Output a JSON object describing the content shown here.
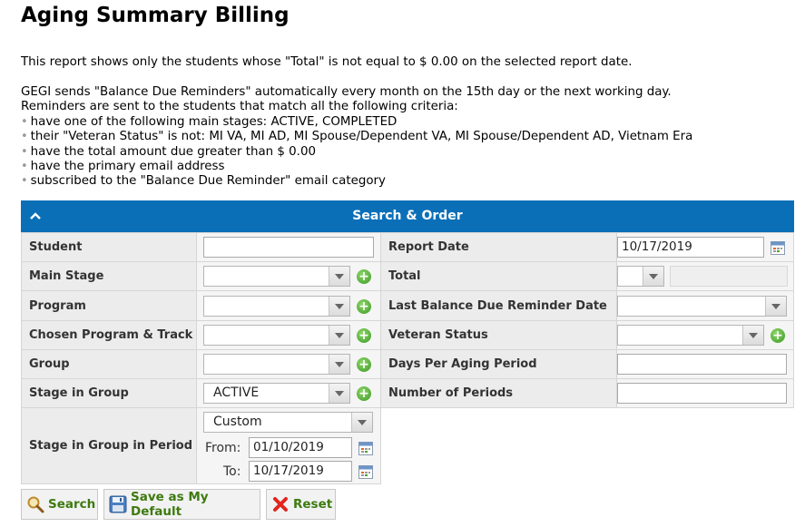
{
  "page": {
    "title": "Aging Summary Billing",
    "intro": "This report shows only the students whose \"Total\" is not equal to $ 0.00 on the selected report date.",
    "reminders_line1": "GEGI sends \"Balance Due Reminders\" automatically every month on the 15th day or the next working day.",
    "reminders_line2": "Reminders are sent to the students that match all the following criteria:",
    "criteria": [
      "have one of the following main stages: ACTIVE, COMPLETED",
      "their \"Veteran Status\" is not: MI VA, MI AD, MI Spouse/Dependent VA, MI Spouse/Dependent AD, Vietnam Era",
      "have the total amount due greater than $ 0.00",
      "have the primary email address",
      "subscribed to the \"Balance Due Reminder\" email category"
    ]
  },
  "panel": {
    "title": "Search & Order",
    "fields": {
      "student": {
        "label": "Student",
        "value": ""
      },
      "main_stage": {
        "label": "Main Stage",
        "value": ""
      },
      "program": {
        "label": "Program",
        "value": ""
      },
      "chosen_program_track": {
        "label": "Chosen Program & Track",
        "value": ""
      },
      "group": {
        "label": "Group",
        "value": ""
      },
      "stage_in_group": {
        "label": "Stage in Group",
        "value": "ACTIVE"
      },
      "stage_in_group_period": {
        "label": "Stage in Group in Period",
        "value": "Custom",
        "from_label": "From:",
        "from_value": "01/10/2019",
        "to_label": "To:",
        "to_value": "10/17/2019"
      },
      "report_date": {
        "label": "Report Date",
        "value": "10/17/2019"
      },
      "total": {
        "label": "Total",
        "operator": "",
        "value": ""
      },
      "last_reminder_date": {
        "label": "Last Balance Due Reminder Date",
        "value": ""
      },
      "veteran_status": {
        "label": "Veteran Status",
        "value": ""
      },
      "days_per_aging_period": {
        "label": "Days Per Aging Period",
        "value": ""
      },
      "number_of_periods": {
        "label": "Number of Periods",
        "value": ""
      }
    }
  },
  "buttons": {
    "search": "Search",
    "save_default": "Save as My Default",
    "reset": "Reset"
  },
  "colors": {
    "header_blue": "#0b6fb8",
    "button_text_green": "#3d7a0f",
    "plus_green": "#3c9a24",
    "reset_red": "#e0261f"
  },
  "icons": {
    "collapse": "chevron-up-icon",
    "add": "plus-circle-icon",
    "calendar": "calendar-icon",
    "search": "magnifier-icon",
    "save": "floppy-disk-icon",
    "reset": "red-x-icon"
  }
}
